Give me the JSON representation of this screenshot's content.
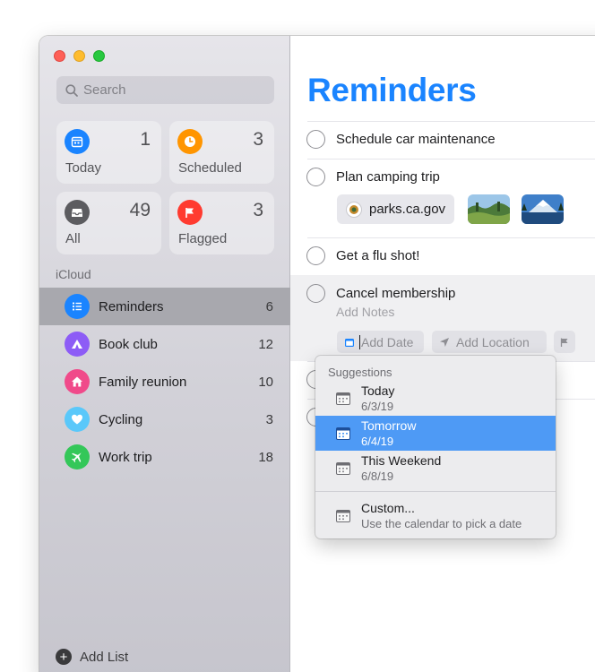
{
  "sidebar": {
    "search_placeholder": "Search",
    "smart_lists": [
      {
        "label": "Today",
        "count": "1",
        "icon": "calendar-icon",
        "color": "#1a84ff"
      },
      {
        "label": "Scheduled",
        "count": "3",
        "icon": "clock-icon",
        "color": "#ff9500"
      },
      {
        "label": "All",
        "count": "49",
        "icon": "tray-icon",
        "color": "#5c5c60"
      },
      {
        "label": "Flagged",
        "count": "3",
        "icon": "flag-icon",
        "color": "#ff3b30"
      }
    ],
    "section_label": "iCloud",
    "lists": [
      {
        "name": "Reminders",
        "count": "6",
        "icon": "list-icon",
        "color": "#1a84ff",
        "selected": true
      },
      {
        "name": "Book club",
        "count": "12",
        "icon": "tent-icon",
        "color": "#8d5cf6"
      },
      {
        "name": "Family reunion",
        "count": "10",
        "icon": "house-icon",
        "color": "#f04a8a"
      },
      {
        "name": "Cycling",
        "count": "3",
        "icon": "heart-icon",
        "color": "#5ac8fa"
      },
      {
        "name": "Work trip",
        "count": "18",
        "icon": "airplane-icon",
        "color": "#34c759"
      }
    ],
    "add_list_label": "Add List"
  },
  "main": {
    "title": "Reminders",
    "reminders": [
      {
        "text": "Schedule car maintenance"
      },
      {
        "text": "Plan camping trip"
      },
      {
        "text": "Get a flu shot!"
      },
      {
        "text": "Cancel membership"
      }
    ],
    "link_chip": "parks.ca.gov",
    "add_notes": "Add Notes",
    "add_date": "Add Date",
    "add_location": "Add Location"
  },
  "popover": {
    "title": "Suggestions",
    "items": [
      {
        "label": "Today",
        "date": "6/3/19"
      },
      {
        "label": "Tomorrow",
        "date": "6/4/19",
        "active": true
      },
      {
        "label": "This Weekend",
        "date": "6/8/19"
      }
    ],
    "custom": {
      "label": "Custom...",
      "sub": "Use the calendar to pick a date"
    }
  },
  "colors": {
    "accent": "#1a84ff",
    "selection": "#4e9af5"
  }
}
